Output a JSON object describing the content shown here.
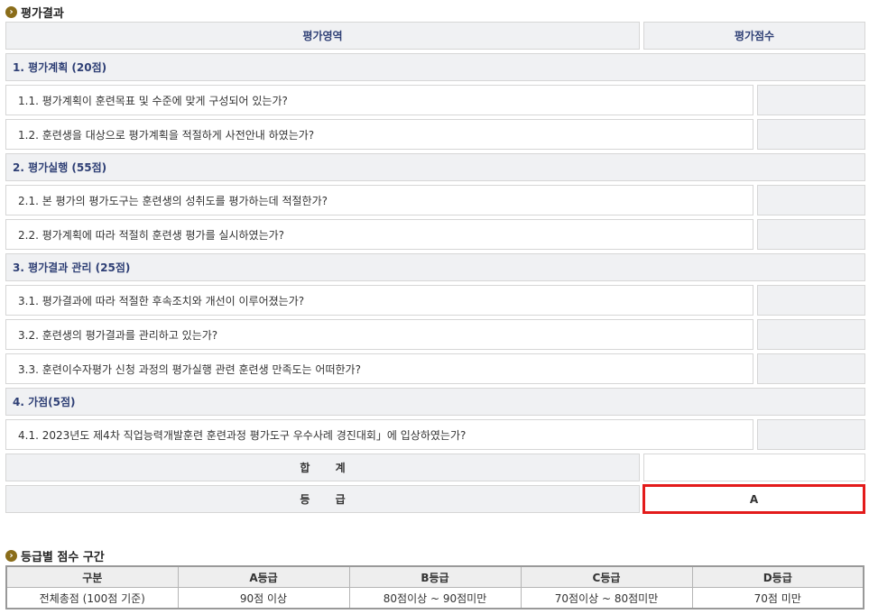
{
  "result": {
    "heading": "평가결과",
    "header": {
      "area_label": "평가영역",
      "score_label": "평가점수"
    },
    "categories": [
      {
        "title": "1. 평가계획 (20점)",
        "items": [
          {
            "text": "1.1. 평가계획이 훈련목표 및 수준에 맞게 구성되어 있는가?"
          },
          {
            "text": "1.2. 훈련생을 대상으로 평가계획을 적절하게 사전안내 하였는가?"
          }
        ]
      },
      {
        "title": "2. 평가실행 (55점)",
        "items": [
          {
            "text": "2.1. 본 평가의 평가도구는 훈련생의 성취도를 평가하는데 적절한가?"
          },
          {
            "text": "2.2. 평가계획에 따라 적절히 훈련생 평가를 실시하였는가?"
          }
        ]
      },
      {
        "title": "3. 평가결과 관리 (25점)",
        "items": [
          {
            "text": "3.1. 평가결과에 따라 적절한 후속조치와 개선이 이루어졌는가?"
          },
          {
            "text": "3.2. 훈련생의 평가결과를 관리하고 있는가?"
          },
          {
            "text": "3.3. 훈련이수자평가 신청 과정의 평가실행 관련 훈련생 만족도는 어떠한가?"
          }
        ]
      },
      {
        "title": "4. 가점(5점)",
        "items": [
          {
            "text": "4.1. 2023년도 제4차 직업능력개발훈련 훈련과정 평가도구 우수사례 경진대회」에 입상하였는가?"
          }
        ]
      }
    ],
    "total_label": "합 계",
    "total_value": "",
    "grade_label": "등 급",
    "grade_value": "A"
  },
  "grade_ranges": {
    "heading": "등급별 점수 구간",
    "columns": [
      "구분",
      "A등급",
      "B등급",
      "C등급",
      "D등급"
    ],
    "row": [
      "전체총점 (100점 기준)",
      "90점 이상",
      "80점이상 ~ 90점미만",
      "70점이상 ~ 80점미만",
      "70점 미만"
    ]
  }
}
